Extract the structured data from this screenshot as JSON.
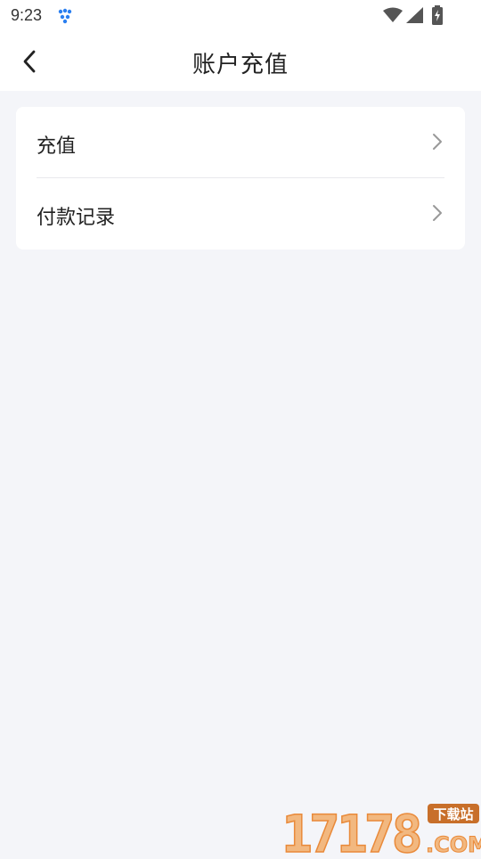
{
  "status_bar": {
    "time": "9:23"
  },
  "header": {
    "title": "账户充值"
  },
  "menu": {
    "items": [
      {
        "label": "充值"
      },
      {
        "label": "付款记录"
      }
    ]
  },
  "watermark": {
    "text": "17178",
    "suffix": ".COM",
    "badge": "下载站"
  },
  "colors": {
    "background": "#f4f5f9",
    "card": "#ffffff",
    "text": "#222222",
    "chevron": "#999999",
    "watermark_orange": "#e98a3a"
  }
}
